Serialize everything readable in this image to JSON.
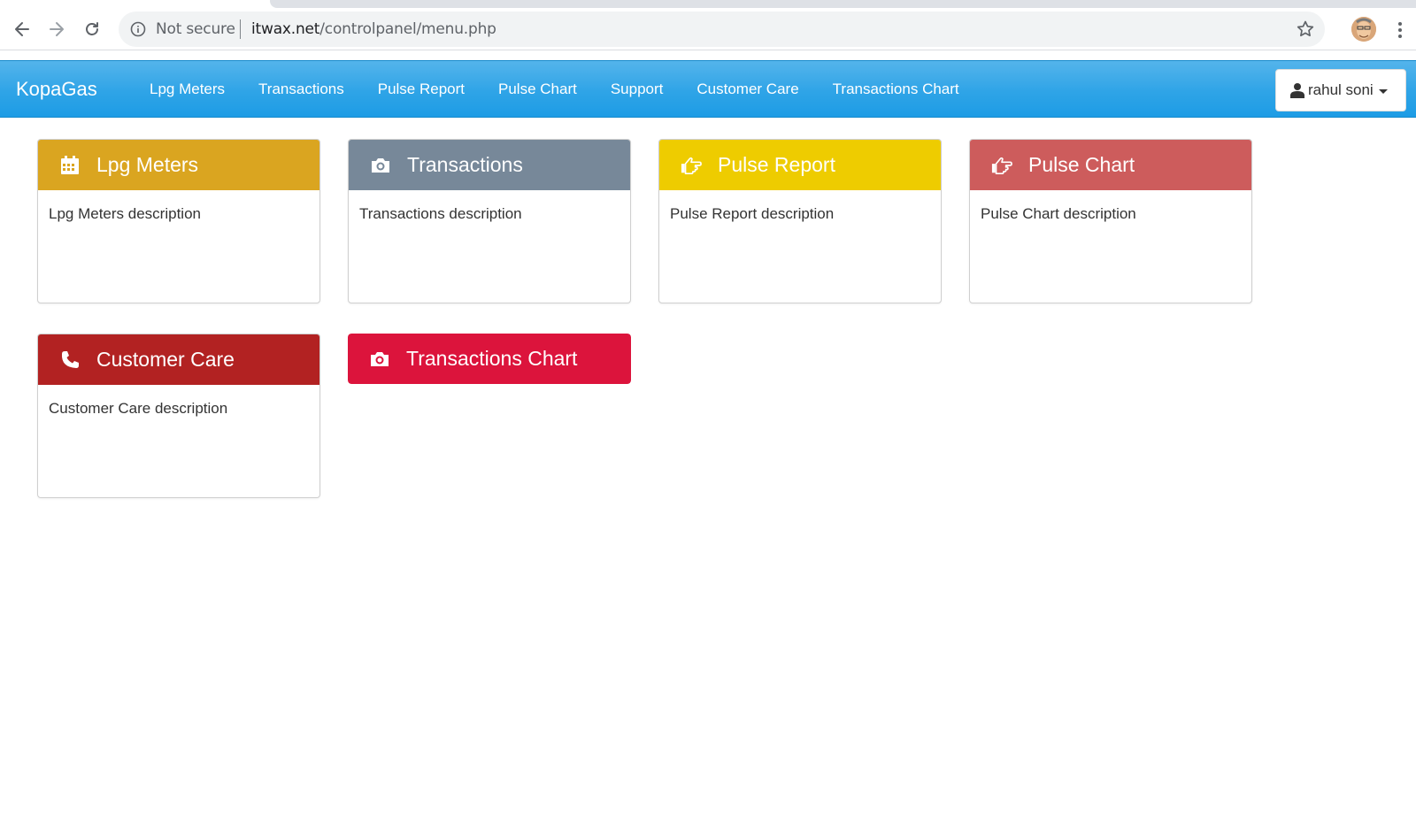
{
  "browser": {
    "security_text": "Not secure",
    "url_host": "itwax.net",
    "url_path": "/controlpanel/menu.php"
  },
  "navbar": {
    "brand": "KopaGas",
    "links": [
      "Lpg Meters",
      "Transactions",
      "Pulse Report",
      "Pulse Chart",
      "Support",
      "Customer Care",
      "Transactions Chart"
    ],
    "user": "rahul soni"
  },
  "panels": [
    {
      "title": "Lpg Meters",
      "description": "Lpg Meters description",
      "color": "#daa520",
      "icon": "calendar-icon"
    },
    {
      "title": "Transactions",
      "description": "Transactions description",
      "color": "#778899",
      "icon": "camera-icon"
    },
    {
      "title": "Pulse Report",
      "description": "Pulse Report description",
      "color": "#eecc00",
      "icon": "hand-point-right-icon"
    },
    {
      "title": "Pulse Chart",
      "description": "Pulse Chart description",
      "color": "#cd5c5c",
      "icon": "hand-point-right-icon"
    },
    {
      "title": "Customer Care",
      "description": "Customer Care description",
      "color": "#b22222",
      "icon": "phone-icon"
    },
    {
      "title": "Transactions Chart",
      "description": "",
      "color": "#dc143c",
      "icon": "camera-icon"
    }
  ]
}
